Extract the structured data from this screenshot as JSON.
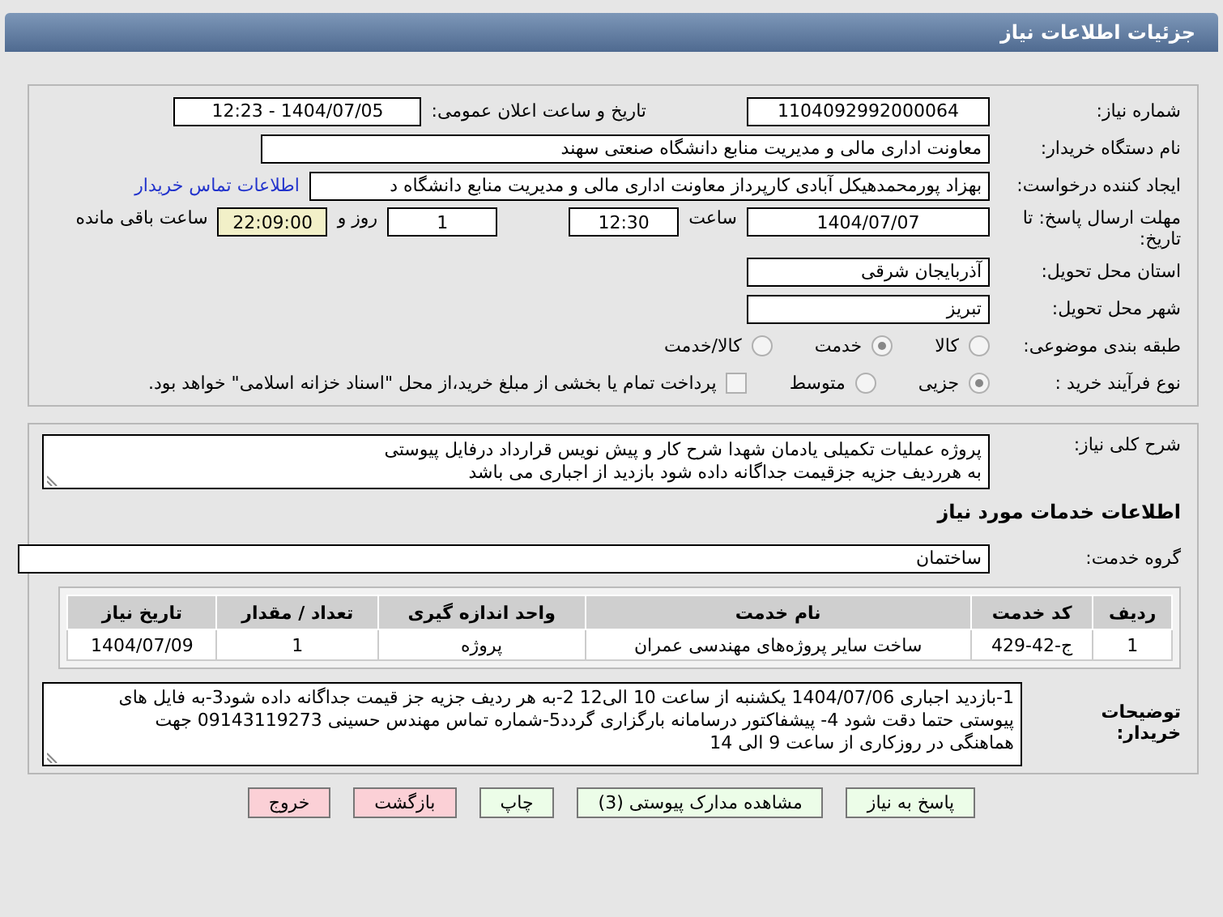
{
  "title": "جزئیات اطلاعات نیاز",
  "need_number": {
    "label": "شماره نیاز:",
    "value": "1104092992000064"
  },
  "announce": {
    "label": "تاریخ و ساعت اعلان عمومی:",
    "value": "1404/07/05 - 12:23"
  },
  "buyer_org": {
    "label": "نام دستگاه خریدار:",
    "value": "معاونت اداری  مالی و مدیریت منابع دانشگاه صنعتی سهند"
  },
  "requester": {
    "label": "ایجاد کننده درخواست:",
    "value": "بهزاد پورمحمدهیکل آبادی کارپرداز معاونت اداری  مالی و مدیریت منابع دانشگاه د",
    "link": "اطلاعات تماس خریدار"
  },
  "deadline": {
    "label": "مهلت ارسال پاسخ: تا تاریخ:",
    "date": "1404/07/07",
    "time_label": "ساعت",
    "time": "12:30",
    "days": "1",
    "days_label": "روز و",
    "remaining": "22:09:00",
    "remaining_label": "ساعت باقی مانده"
  },
  "province": {
    "label": "استان محل تحویل:",
    "value": "آذربایجان شرقی"
  },
  "city": {
    "label": "شهر محل تحویل:",
    "value": "تبریز"
  },
  "category": {
    "label": "طبقه بندی موضوعی:",
    "options": [
      {
        "label": "کالا",
        "selected": false
      },
      {
        "label": "خدمت",
        "selected": true
      },
      {
        "label": "کالا/خدمت",
        "selected": false
      }
    ]
  },
  "purchase_type": {
    "label": "نوع فرآیند خرید :",
    "options": [
      {
        "label": "جزیی",
        "selected": true
      },
      {
        "label": "متوسط",
        "selected": false
      }
    ],
    "payment": {
      "checked": false,
      "label": "پرداخت تمام یا بخشی از مبلغ خرید،از محل \"اسناد خزانه اسلامی\" خواهد بود."
    }
  },
  "description": {
    "label": "شرح کلی نیاز:",
    "value": "پروژه عملیات تکمیلی یادمان شهدا شرح کار و پیش نویس قرارداد درفایل پیوستی\nبه هرردیف جزیه جزقیمت جداگانه داده شود بازدید از اجباری می باشد"
  },
  "services_title": "اطلاعات خدمات مورد نیاز",
  "service_group": {
    "label": "گروه خدمت:",
    "value": "ساختمان"
  },
  "table": {
    "columns": [
      "ردیف",
      "کد خدمت",
      "نام خدمت",
      "واحد اندازه گیری",
      "تعداد / مقدار",
      "تاریخ نیاز"
    ],
    "rows": [
      [
        "1",
        "ج-42-429",
        "ساخت سایر پروژه‌های مهندسی عمران",
        "پروژه",
        "1",
        "1404/07/09"
      ]
    ]
  },
  "buyer_notes": {
    "label": "توضیحات خریدار:",
    "value": "1-بازدید اجباری 1404/07/06 یکشنبه از ساعت 10 الی12 2-به هر ردیف جزیه جز قیمت جداگانه داده شود3-به فایل های\nپیوستی حتما دقت شود 4- پیشفاکتور درسامانه بارگزاری گردد5-شماره تماس مهندس حسینی 09143119273 جهت\nهماهنگی در روزکاری از ساعت 9 الی 14"
  },
  "buttons": [
    {
      "label": "پاسخ به نیاز",
      "kind": "action"
    },
    {
      "label": "مشاهده مدارک پیوستی (3)",
      "kind": "action"
    },
    {
      "label": "چاپ",
      "kind": "action"
    },
    {
      "label": "بازگشت",
      "kind": "leave"
    },
    {
      "label": "خروج",
      "kind": "leave"
    }
  ]
}
